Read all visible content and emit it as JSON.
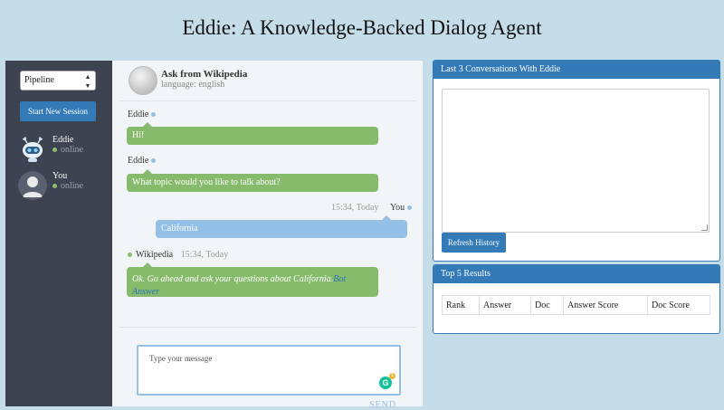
{
  "page_title": "Eddie: A Knowledge-Backed Dialog Agent",
  "sidebar": {
    "mode_select": "Pipeline",
    "start_button": "Start New Session",
    "contacts": [
      {
        "name": "Eddie",
        "status": "online",
        "icon": "robot-avatar-icon"
      },
      {
        "name": "You",
        "status": "online",
        "icon": "user-avatar-icon"
      }
    ]
  },
  "chat": {
    "header_title": "Ask from Wikipedia",
    "header_subtitle": "language: english",
    "messages": [
      {
        "sender": "Eddie",
        "time": "",
        "text": "Hi!",
        "side": "left"
      },
      {
        "sender": "Eddie",
        "time": "",
        "text": "What topic would you like to talk about?",
        "side": "left"
      },
      {
        "sender": "You",
        "time": "15:34, Today",
        "text": "California",
        "side": "right"
      },
      {
        "sender": "Wikipedia",
        "time": "15:34, Today",
        "text": "Ok. Go ahead and ask your questions about California.",
        "link": "Bot Answer",
        "side": "left"
      }
    ],
    "input_placeholder": "Type your message",
    "send_label": "SEND"
  },
  "history_panel": {
    "title": "Last 3 Conversations With Eddie",
    "refresh_button": "Refresh History"
  },
  "results_panel": {
    "title": "Top 5 Results",
    "columns": [
      "Rank",
      "Answer",
      "Doc",
      "Answer Score",
      "Doc Score"
    ]
  },
  "colors": {
    "background": "#c5dde9",
    "sidebar": "#3e4352",
    "accent": "#337ab7",
    "bot_bubble": "#86bb6b",
    "user_bubble": "#94c0e8"
  }
}
